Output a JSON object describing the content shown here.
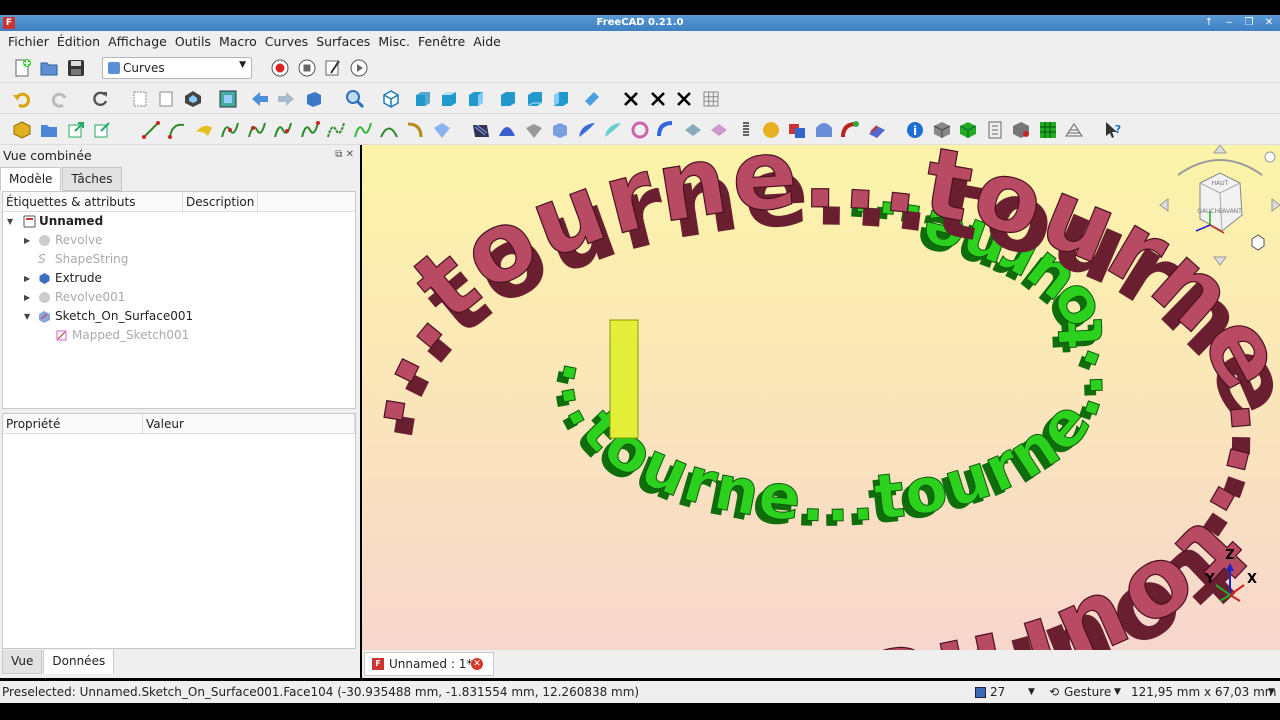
{
  "window": {
    "title": "FreeCAD 0.21.0",
    "app_icon": "freecad-icon",
    "controls": [
      "↑",
      "‒",
      "❐",
      "✕"
    ]
  },
  "menu": [
    "Fichier",
    "Édition",
    "Affichage",
    "Outils",
    "Macro",
    "Curves",
    "Surfaces",
    "Misc.",
    "Fenêtre",
    "Aide"
  ],
  "toolbar": {
    "workbench_label": "Curves"
  },
  "combo_view": {
    "title": "Vue combinée",
    "tabs": [
      "Modèle",
      "Tâches"
    ],
    "tree_headers": [
      "Étiquettes & attributs",
      "Description"
    ],
    "tree": [
      {
        "label": "Unnamed",
        "bold": true
      },
      {
        "label": "Revolve",
        "hidden": true
      },
      {
        "label": "ShapeString",
        "hidden": true
      },
      {
        "label": "Extrude",
        "hidden": false
      },
      {
        "label": "Revolve001",
        "hidden": true
      },
      {
        "label": "Sketch_On_Surface001",
        "hidden": false
      },
      {
        "label": "Mapped_Sketch001",
        "hidden": true
      }
    ],
    "prop_headers": [
      "Propriété",
      "Valeur"
    ],
    "bottom_tabs": [
      "Vue",
      "Données"
    ]
  },
  "viewport": {
    "outer_text": "...tourne...tourne...tourne...",
    "inner_text": "...tourne...tourne...tourne...",
    "axis_labels": {
      "z": "Z",
      "y": "Y",
      "x": "X"
    },
    "navcube_labels": [
      "HAUT",
      "GAUCHE",
      "AVANT"
    ],
    "colors": {
      "outer": "#b84b63",
      "inner": "#27c31b",
      "highlight": "#e8f03a"
    }
  },
  "doc_tab": {
    "label": "Unnamed : 1*"
  },
  "status": {
    "message": "Preselected: Unnamed.Sketch_On_Surface001.Face104 (-30.935488 mm, -1.831554 mm, 12.260838 mm)",
    "count": "27",
    "nav_style": "Gesture",
    "dimensions": "121,95 mm x 67,03 mm"
  }
}
